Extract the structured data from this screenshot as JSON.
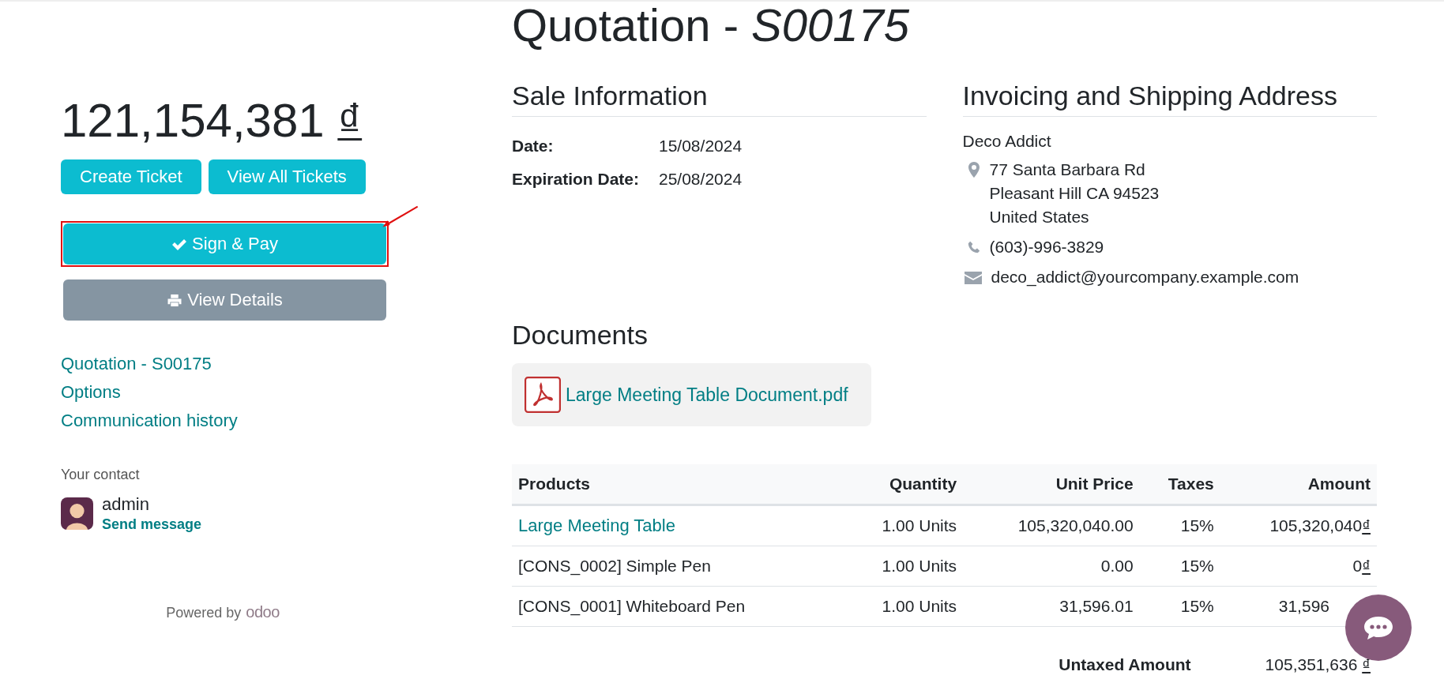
{
  "sidebar": {
    "total": "121,154,381",
    "currency": "₫",
    "ticket_buttons": [
      "Create Ticket",
      "View All Tickets"
    ],
    "actions": [
      {
        "label": "Sign & Pay",
        "kind": "sign",
        "highlighted": true
      },
      {
        "label": "View Details",
        "kind": "print",
        "highlighted": false
      }
    ],
    "links": [
      "Quotation - S00175",
      "Options",
      "Communication history"
    ],
    "contact": {
      "heading": "Your contact",
      "name": "admin",
      "action": "Send message"
    },
    "powered_by": "Powered by",
    "brand": "odoo"
  },
  "title": "Quotation - *S00175*",
  "sale_information": {
    "heading": "Sale Information",
    "fields": [
      {
        "label": "Date:",
        "value": "15/08/2024"
      },
      {
        "label": "Expiration Date:",
        "value": "25/08/2024"
      }
    ]
  },
  "address": {
    "heading": "Invoicing and Shipping Address",
    "name": "Deco Addict",
    "lines": [
      {
        "kind": "location",
        "text": [
          "77 Santa Barbara Rd",
          "Pleasant Hill CA 94523",
          "United States"
        ]
      },
      {
        "kind": "phone",
        "text": [
          "(603)-996-3829"
        ]
      },
      {
        "kind": "email",
        "text": [
          "deco_addict@yourcompany.example.com"
        ]
      }
    ]
  },
  "documents": {
    "heading": "Documents",
    "files": [
      "Large Meeting Table Document.pdf"
    ]
  },
  "table": {
    "columns": [
      "Products",
      "Quantity",
      "Unit Price",
      "Taxes",
      "Amount"
    ],
    "rows": [
      {
        "product": "Large Meeting Table",
        "link": true,
        "quantity": "1.00 Units",
        "unit_price": "105,320,040.00",
        "taxes": "15%",
        "amount": "105,320,040",
        "currency": "₫",
        "cut": false
      },
      {
        "product": "[CONS_0002] Simple Pen",
        "link": false,
        "quantity": "1.00 Units",
        "unit_price": "0.00",
        "taxes": "15%",
        "amount": "0",
        "currency": "₫",
        "cut": false
      },
      {
        "product": "[CONS_0001] Whiteboard Pen",
        "link": false,
        "quantity": "1.00 Units",
        "unit_price": "31,596.01",
        "taxes": "15%",
        "amount": "31,596",
        "cut": true
      }
    ],
    "totals": [
      {
        "label": "Untaxed Amount",
        "value": "105,351,636",
        "currency": "₫"
      }
    ]
  }
}
